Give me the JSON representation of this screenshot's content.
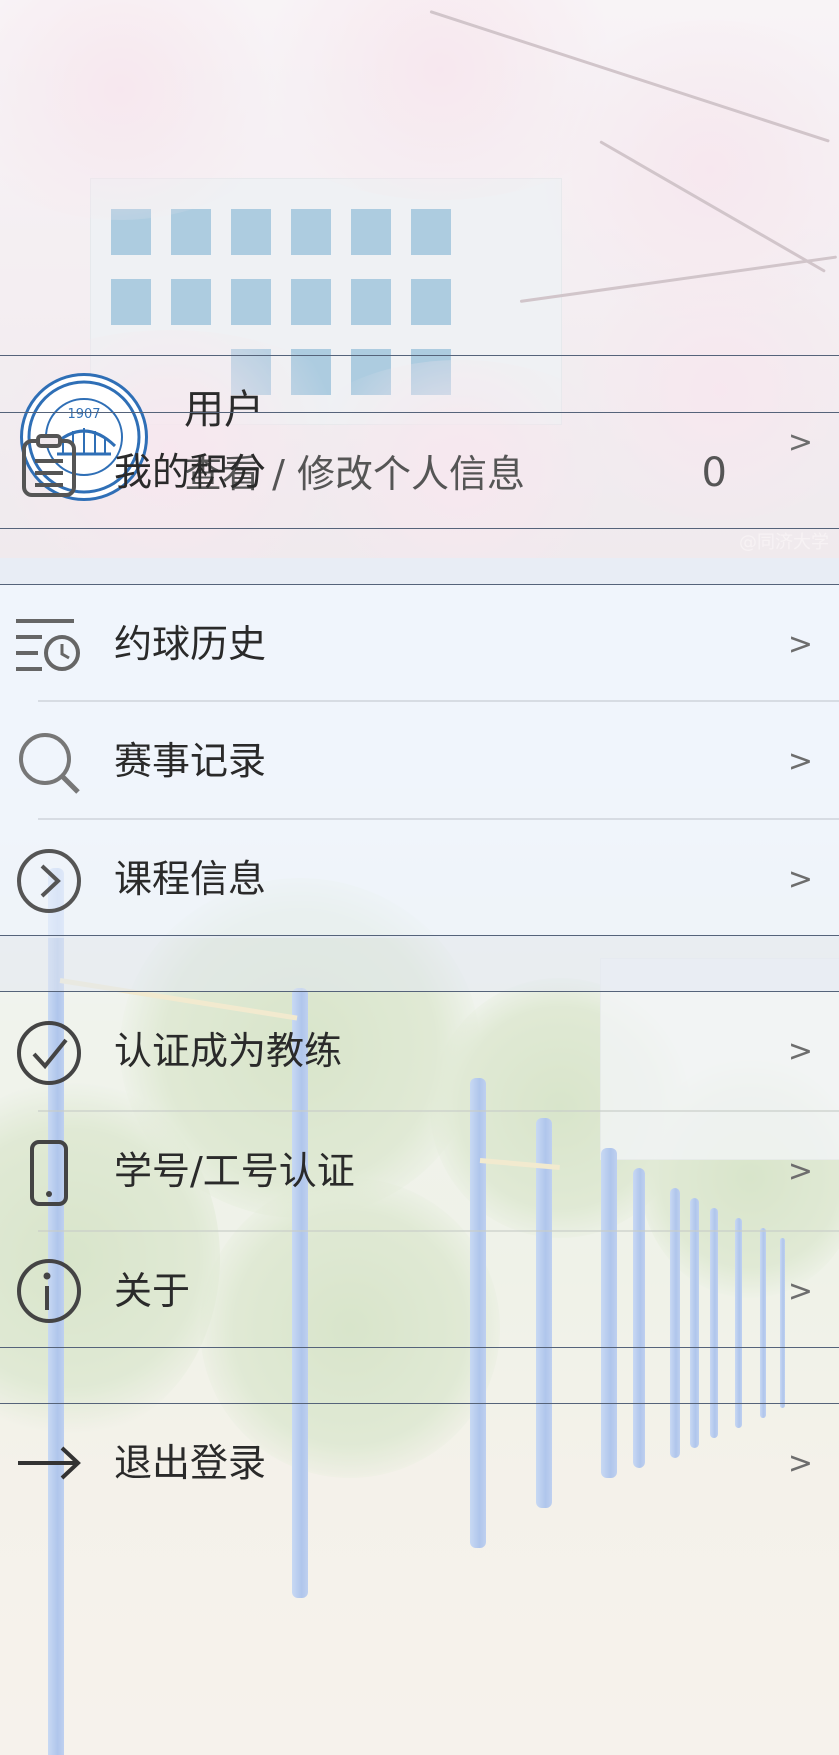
{
  "profile": {
    "name": "用户",
    "subtitle": "查看 / 修改个人信息",
    "chevron": ">",
    "avatar_icon": "tongji-university-logo",
    "avatar_text": "1907"
  },
  "points": {
    "label": "我的积分",
    "value": "0",
    "icon": "clipboard-icon"
  },
  "watermark": "@同济大学",
  "menu_group_1": [
    {
      "label": "约球历史",
      "icon": "history-clock-icon",
      "chevron": ">"
    },
    {
      "label": "赛事记录",
      "icon": "search-icon",
      "chevron": ">"
    },
    {
      "label": "课程信息",
      "icon": "chevron-circle-icon",
      "chevron": ">"
    }
  ],
  "menu_group_2": [
    {
      "label": "认证成为教练",
      "icon": "check-circle-icon",
      "chevron": ">"
    },
    {
      "label": "学号/工号认证",
      "icon": "phone-icon",
      "chevron": ">"
    },
    {
      "label": "关于",
      "icon": "info-icon",
      "chevron": ">"
    }
  ],
  "logout": {
    "label": "退出登录",
    "icon": "arrow-right-icon",
    "chevron": ">"
  }
}
